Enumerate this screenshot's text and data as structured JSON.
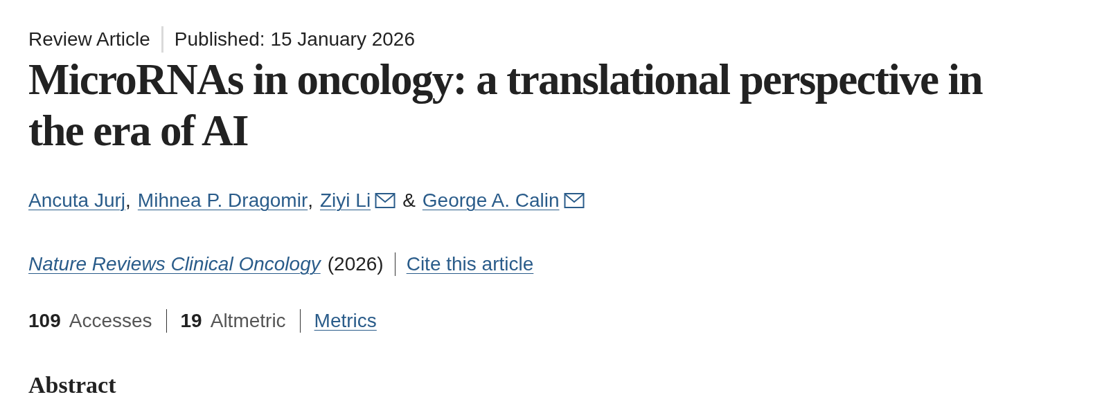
{
  "article_type": "Review Article",
  "published": "Published: 15 January 2026",
  "title": "MicroRNAs in oncology: a translational perspective in the era of AI",
  "authors": [
    {
      "name": "Ancuta Jurj",
      "separator": ",",
      "email": false
    },
    {
      "name": "Mihnea P. Dragomir",
      "separator": ",",
      "email": false
    },
    {
      "name": "Ziyi Li",
      "separator": "&",
      "email": true
    },
    {
      "name": "George A. Calin",
      "email": true
    }
  ],
  "journal": "Nature Reviews Clinical Oncology",
  "year": "(2026)",
  "cite": "Cite this article",
  "metrics": [
    {
      "count": "109",
      "name": "Accesses"
    },
    {
      "count": "19",
      "name": "Altmetric"
    }
  ],
  "metrics_link": "Metrics",
  "section_heading": "Abstract"
}
